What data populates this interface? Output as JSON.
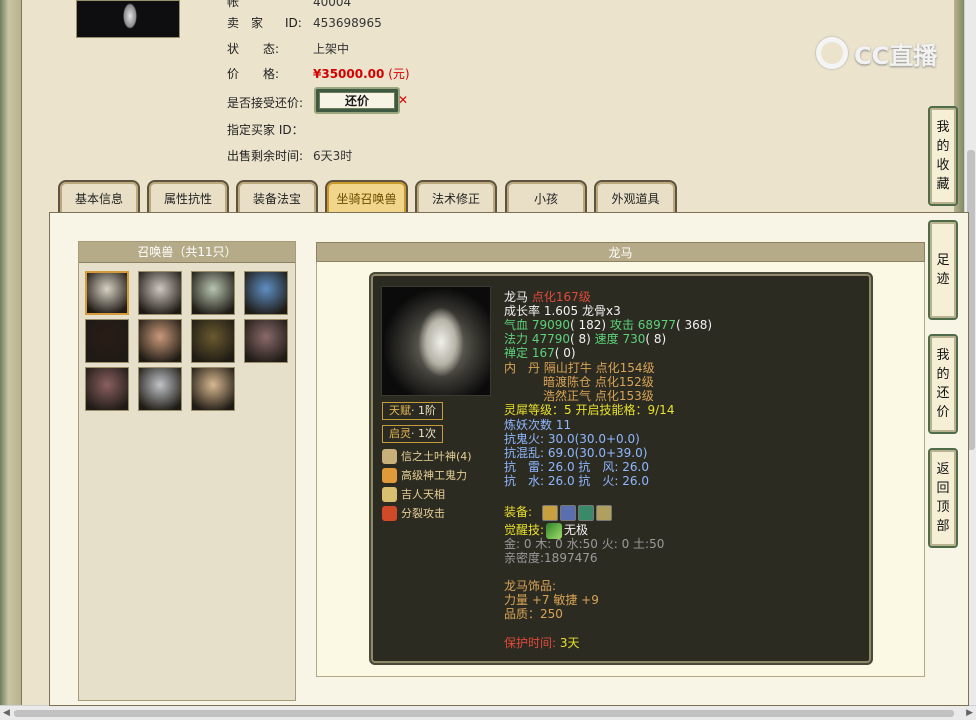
{
  "seller": {
    "top_label_partial": "帐",
    "top_value_partial": "40004",
    "seller_label": "卖　家",
    "seller_id_prefix": "ID:",
    "seller_id": "453698965",
    "status_label": "状　　态:",
    "status_value": "上架中",
    "price_label": "价　　格:",
    "price_value": "¥35000.00",
    "price_unit": "(元)",
    "counter_label": "是否接受还价:",
    "counter_button": "还价",
    "counter_mark": "✕",
    "buyer_label": "指定买家 ID：",
    "remaining_label": "出售剩余时间:",
    "remaining_value": "6天3时"
  },
  "brand": {
    "logo_text": "CC直播"
  },
  "tabs": [
    {
      "label": "基本信息"
    },
    {
      "label": "属性抗性"
    },
    {
      "label": "装备法宝"
    },
    {
      "label": "坐骑召唤兽",
      "active": true
    },
    {
      "label": "法术修正"
    },
    {
      "label": "小孩"
    },
    {
      "label": "外观道具"
    }
  ],
  "summon": {
    "header": "召唤兽（共11只）",
    "portraits": [
      {
        "icon": "white-dragon-portrait",
        "color": "#d8d2c4"
      },
      {
        "icon": "fox-maiden-portrait",
        "color": "#cfc6c0"
      },
      {
        "icon": "lady-portrait",
        "color": "#b8c4b0"
      },
      {
        "icon": "ice-spirit-portrait",
        "color": "#5f8fc4"
      },
      {
        "icon": "dark-warrior-portrait",
        "color": "#2a1c16"
      },
      {
        "icon": "girl-portrait",
        "color": "#c99a7a"
      },
      {
        "icon": "beast-portrait",
        "color": "#6a5a30"
      },
      {
        "icon": "red-dragon-portrait",
        "color": "#8a6a6a"
      },
      {
        "icon": "red-dragon-portrait-2",
        "color": "#8a6060"
      },
      {
        "icon": "white-monkey-portrait",
        "color": "#bfc4c8"
      },
      {
        "icon": "blonde-girl-portrait",
        "color": "#d8b890"
      }
    ]
  },
  "detail": {
    "header": "龙马",
    "badges": {
      "talent_label": "天赋",
      "talent_value": "· 1阶",
      "spirit_label": "启灵",
      "spirit_value": "· 1次"
    },
    "skills": [
      {
        "name": "信之土叶神(4)",
        "icon": "earth-skill-icon",
        "color": "#c9b07a"
      },
      {
        "name": "高级神工鬼力",
        "icon": "power-skill-icon",
        "color": "#e09a3a"
      },
      {
        "name": "吉人天相",
        "icon": "luck-skill-icon",
        "color": "#d8c070"
      },
      {
        "name": "分裂攻击",
        "icon": "split-attack-icon",
        "color": "#d04a2a"
      }
    ],
    "stats": {
      "name": "龙马",
      "level": "点化167级",
      "growth": "成长率 1.605 龙骨x3",
      "hp_label": "气血",
      "hp_value": "79090",
      "hp_extra": "( 182)",
      "atk_label": "攻击",
      "atk_value": "68977",
      "atk_extra": "( 368)",
      "mp_label": "法力",
      "mp_value": "47790",
      "mp_extra": "( 8)",
      "spd_label": "速度",
      "spd_value": "730",
      "spd_extra": "( 8)",
      "calm_label": "禅定",
      "calm_value": "167",
      "calm_extra": "( 0)",
      "inner_label": "内　丹",
      "inner_1": "隔山打牛 点化154级",
      "inner_2": "暗渡陈仓 点化152级",
      "inner_3": "浩然正气 点化153级",
      "rhino_label": "灵犀等级：",
      "rhino_value": "5",
      "skill_grid_label": "开启技能格：",
      "skill_grid_value": "9/14",
      "refine": "炼妖次数 11",
      "res_ghost": "抗鬼火: 30.0(30.0+0.0)",
      "res_chaos": "抗混乱: 69.0(30.0+39.0)",
      "res_thunder": "抗　雷: 26.0 抗　风: 26.0",
      "res_water": "抗　水: 26.0 抗　火: 26.0",
      "equip_label": "装备:",
      "equip_icons": [
        {
          "icon": "ring-equip-icon",
          "color": "#c8a040"
        },
        {
          "icon": "armor-equip-icon",
          "color": "#5a6fb0"
        },
        {
          "icon": "collar-equip-icon",
          "color": "#3a8a6a"
        },
        {
          "icon": "horn-equip-icon",
          "color": "#b0a060"
        }
      ],
      "awaken_label": "觉醒技:",
      "awaken_value": "无极",
      "elements": "金: 0 木: 0 水:50 火: 0 土:50",
      "intimacy": "亲密度:1897476",
      "ornament_title": "龙马饰品:",
      "ornament_stats": "力量 +7 敏捷 +9",
      "quality": "品质：250",
      "protect_label": "保护时间:",
      "protect_value": "3天"
    }
  },
  "side_nav": [
    {
      "label": "我的收藏"
    },
    {
      "label": "足迹"
    },
    {
      "label": "我的还价"
    },
    {
      "label": "返回顶部"
    }
  ]
}
